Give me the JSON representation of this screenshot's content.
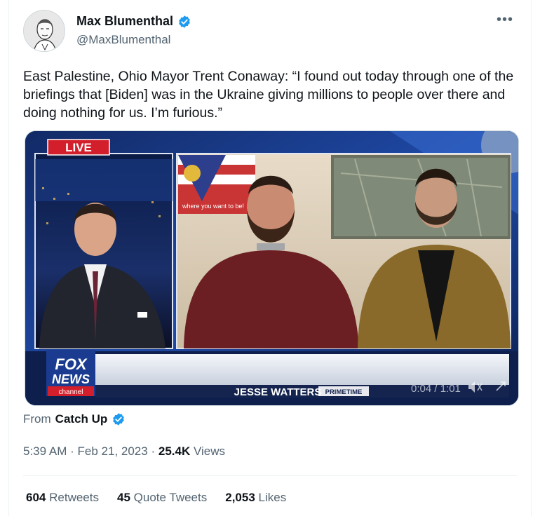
{
  "author": {
    "display_name": "Max Blumenthal",
    "handle": "@MaxBlumenthal",
    "verified_color": "#1d9bf0"
  },
  "more_icon": "•••",
  "tweet": {
    "text": "East Palestine, Ohio Mayor Trent Conaway: “I found out today through one of the briefings that [Biden] was in the Ukraine giving millions to people over there and doing nothing for us. I’m furious.”"
  },
  "video": {
    "live_badge": "LIVE",
    "logo_line1": "FOX",
    "logo_line2": "NEWS",
    "logo_line3": "channel",
    "show_name": "JESSE WATTERS",
    "show_suffix": "PRIMETIME",
    "time": "0:04 / 1:01",
    "flag_text": "where you want to be!"
  },
  "source": {
    "prefix": "From",
    "name": "Catch Up"
  },
  "meta": {
    "time": "5:39 AM",
    "sep": "·",
    "date": "Feb 21, 2023",
    "views_count": "25.4K",
    "views_label": "Views"
  },
  "stats": {
    "retweets_count": "604",
    "retweets_label": "Retweets",
    "quotes_count": "45",
    "quotes_label": "Quote Tweets",
    "likes_count": "2,053",
    "likes_label": "Likes"
  }
}
